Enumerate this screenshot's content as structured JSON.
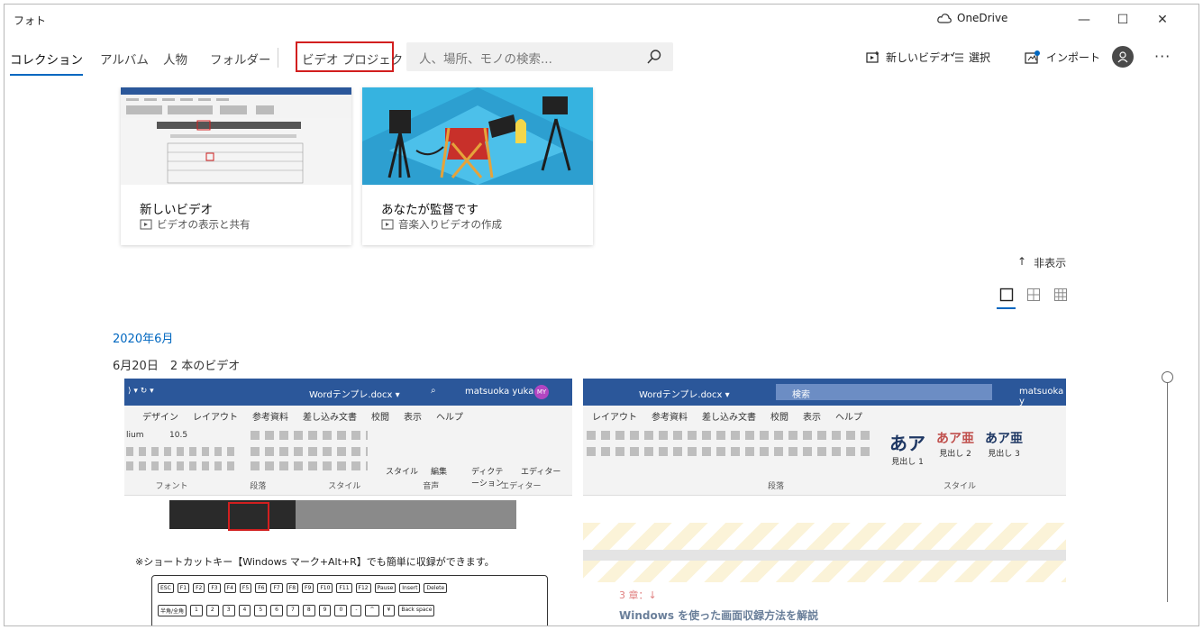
{
  "window": {
    "title": "フォト",
    "onedrive_label": "OneDrive",
    "minimize": "—",
    "maximize": "☐",
    "close": "✕"
  },
  "nav": {
    "tabs": [
      {
        "label": "コレクション"
      },
      {
        "label": "アルバム"
      },
      {
        "label": "人物"
      },
      {
        "label": "フォルダー"
      },
      {
        "label": "ビデオ プロジェクト"
      }
    ],
    "search_placeholder": "人、場所、モノの検索...",
    "actions": {
      "new_video": "新しいビデオ",
      "select": "選択",
      "import": "インポート"
    },
    "more": "···"
  },
  "cards": [
    {
      "title": "新しいビデオ",
      "subtitle": "ビデオの表示と共有"
    },
    {
      "title": "あなたが監督です",
      "subtitle": "音楽入りビデオの作成"
    }
  ],
  "hide_toggle": {
    "arrow": "↑",
    "label": "非表示"
  },
  "gallery": {
    "month": "2020年6月",
    "day_group": "6月20日　2 本のビデオ"
  },
  "thumb1": {
    "doc_title": "Wordテンプレ.docx ▾",
    "user": "matsuoka yuka",
    "user_initials": "MY",
    "menu": [
      "デザイン",
      "レイアウト",
      "参考資料",
      "差し込み文書",
      "校閲",
      "表示",
      "ヘルプ"
    ],
    "font_name": "lium",
    "font_size": "10.5",
    "groups": [
      "フォント",
      "段落",
      "スタイル",
      "音声",
      "エディター"
    ],
    "tools": [
      "スタイル",
      "編集",
      "ディクテーション",
      "エディター"
    ],
    "shortcut_text": "※ショートカットキー【Windows マーク+Alt+R】でも簡単に収録ができます。",
    "keys_row1": [
      "ESC",
      "F1",
      "F2",
      "F3",
      "F4",
      "F5",
      "F6",
      "F7",
      "F8",
      "F9",
      "F10",
      "F11",
      "F12",
      "Pause",
      "Insert",
      "Delete"
    ],
    "keys_row2": [
      "半角/全角",
      "1",
      "2",
      "3",
      "4",
      "5",
      "6",
      "7",
      "8",
      "9",
      "0",
      "-",
      "^",
      "¥",
      "Back space"
    ]
  },
  "thumb2": {
    "doc_title": "Wordテンプレ.docx ▾",
    "search": "検索",
    "user": "matsuoka y",
    "menu": [
      "レイアウト",
      "参考資料",
      "差し込み文書",
      "校閲",
      "表示",
      "ヘルプ"
    ],
    "styles": [
      {
        "big": "あア",
        "label": "見出し 1"
      },
      {
        "big": "あア亜",
        "label": "見出し 2"
      },
      {
        "big": "あア亜",
        "label": "見出し 3"
      }
    ],
    "groups": [
      "段落",
      "スタイル"
    ],
    "heading": "3 章：↓",
    "body_title": "Windows を使った画面収録方法を解説"
  }
}
